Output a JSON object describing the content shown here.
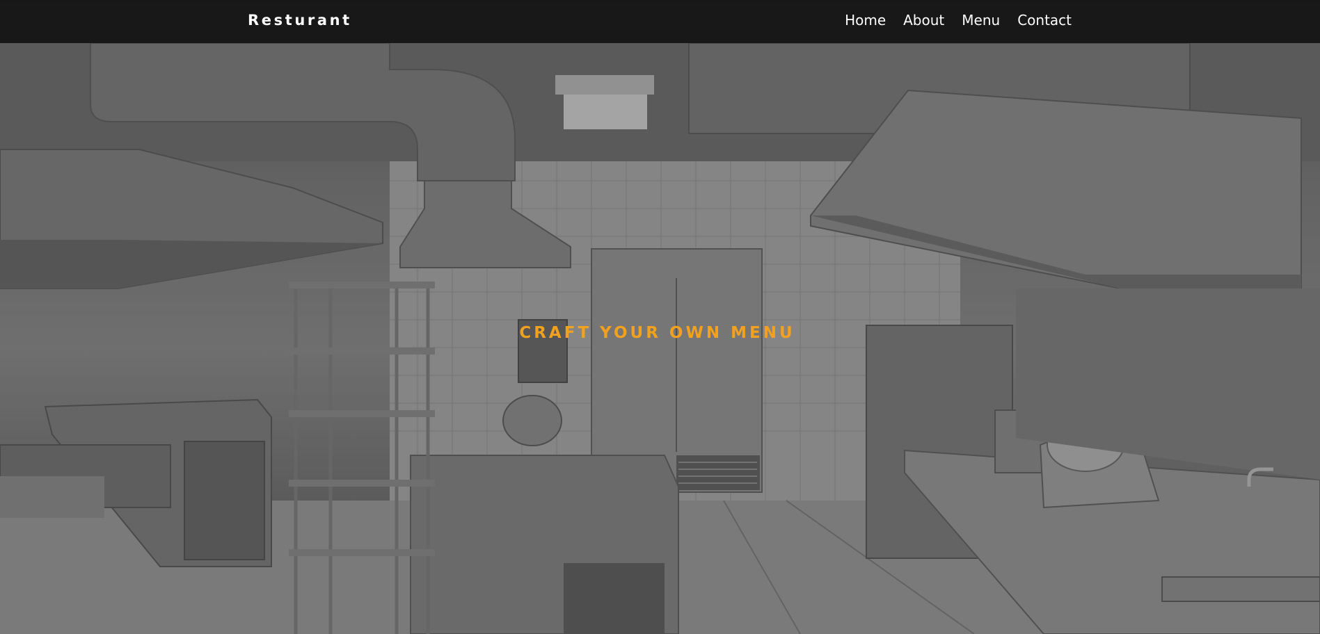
{
  "navbar": {
    "brand": "Resturant",
    "links": [
      {
        "label": "Home"
      },
      {
        "label": "About"
      },
      {
        "label": "Menu"
      },
      {
        "label": "Contact"
      }
    ]
  },
  "hero": {
    "headline": "CRAFT YOUR OWN MENU",
    "background": "commercial-kitchen-photo"
  },
  "colors": {
    "accent": "#f2a11f",
    "navbar_bg": "#121212",
    "text": "#ffffff"
  }
}
